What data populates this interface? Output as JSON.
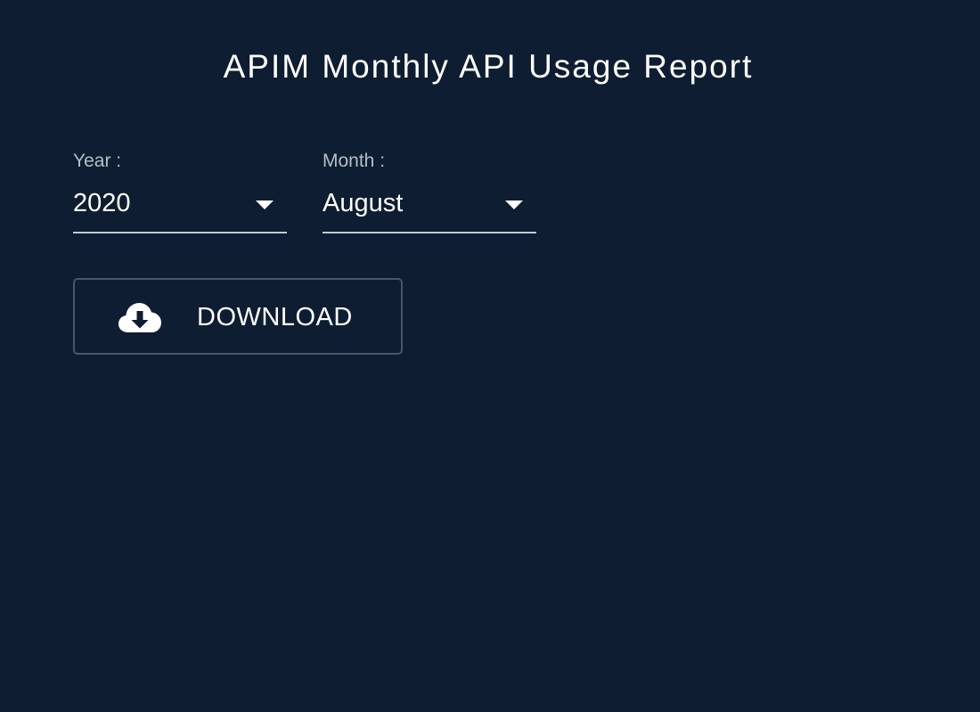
{
  "header": {
    "title": "APIM Monthly API Usage Report"
  },
  "filters": {
    "year": {
      "label": "Year :",
      "value": "2020"
    },
    "month": {
      "label": "Month :",
      "value": "August"
    }
  },
  "actions": {
    "download_label": "DOWNLOAD",
    "download_icon": "cloud-download-icon"
  },
  "colors": {
    "background": "#0e1d31",
    "text": "#ffffff",
    "label": "#b7bec8",
    "underline": "#c4c9d0",
    "button_border": "#4a5566"
  }
}
